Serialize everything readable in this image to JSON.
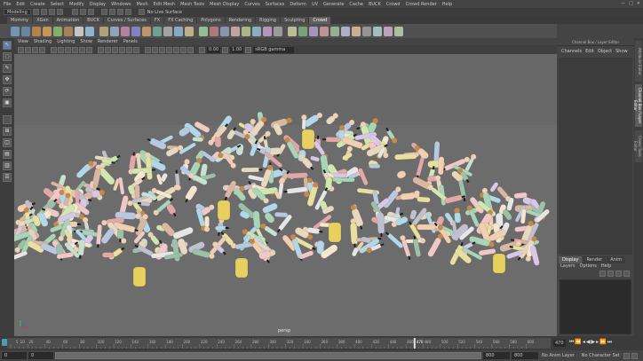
{
  "menubar": {
    "items": [
      "File",
      "Edit",
      "Create",
      "Select",
      "Modify",
      "Display",
      "Windows",
      "Mesh",
      "Edit Mesh",
      "Mesh Tools",
      "Mesh Display",
      "Curves",
      "Surfaces",
      "Deform",
      "UV",
      "Generate",
      "Cache",
      "BUCK",
      "Crowd",
      "Crowd Render",
      "Help"
    ]
  },
  "statusline": {
    "mode": "Modeling",
    "live_surface": "No Live Surface"
  },
  "shelf_tabs": [
    "Mommy",
    "XGen",
    "Animation",
    "BUCK",
    "Curves / Surfaces",
    "FX",
    "FX Caching",
    "Polygons",
    "Rendering",
    "Rigging",
    "Sculpting",
    "Crowd"
  ],
  "active_shelf_tab": "Crowd",
  "viewport_menu": [
    "View",
    "Shading",
    "Lighting",
    "Show",
    "Renderer",
    "Panels"
  ],
  "viewport_toolbar": {
    "exposure": "0.00",
    "gamma": "1.00",
    "color_space": "sRGB gamma"
  },
  "viewport": {
    "camera_label": "persp",
    "bg_top": "#686868",
    "bg_bottom": "#6c6c6c"
  },
  "right_panel": {
    "title": "Channel Box / Layer Editor",
    "menu": [
      "Channels",
      "Edit",
      "Object",
      "Show"
    ],
    "tabs": [
      "Display",
      "Render",
      "Anim"
    ],
    "active_tab": "Display",
    "layer_menu": [
      "Layers",
      "Options",
      "Help"
    ]
  },
  "side_tabs": [
    "Attribute Editor",
    "Channel Box / Layer Editor",
    "Crowd Tools Editor"
  ],
  "timeline": {
    "ticks": [
      "5",
      "10",
      "20",
      "40",
      "60",
      "80",
      "100",
      "120",
      "140",
      "160",
      "180",
      "200",
      "220",
      "240",
      "260",
      "280",
      "300",
      "320",
      "340",
      "360",
      "380",
      "400",
      "420",
      "440",
      "460",
      "480",
      "500",
      "520",
      "540",
      "560",
      "580",
      "600"
    ],
    "current_frame": "470",
    "current_frame_box": "470"
  },
  "range": {
    "start": "0",
    "range_start": "0",
    "range_end": "800",
    "end": "800",
    "anim_layer": "No Anim Layer",
    "character_set": "No Character Set"
  }
}
